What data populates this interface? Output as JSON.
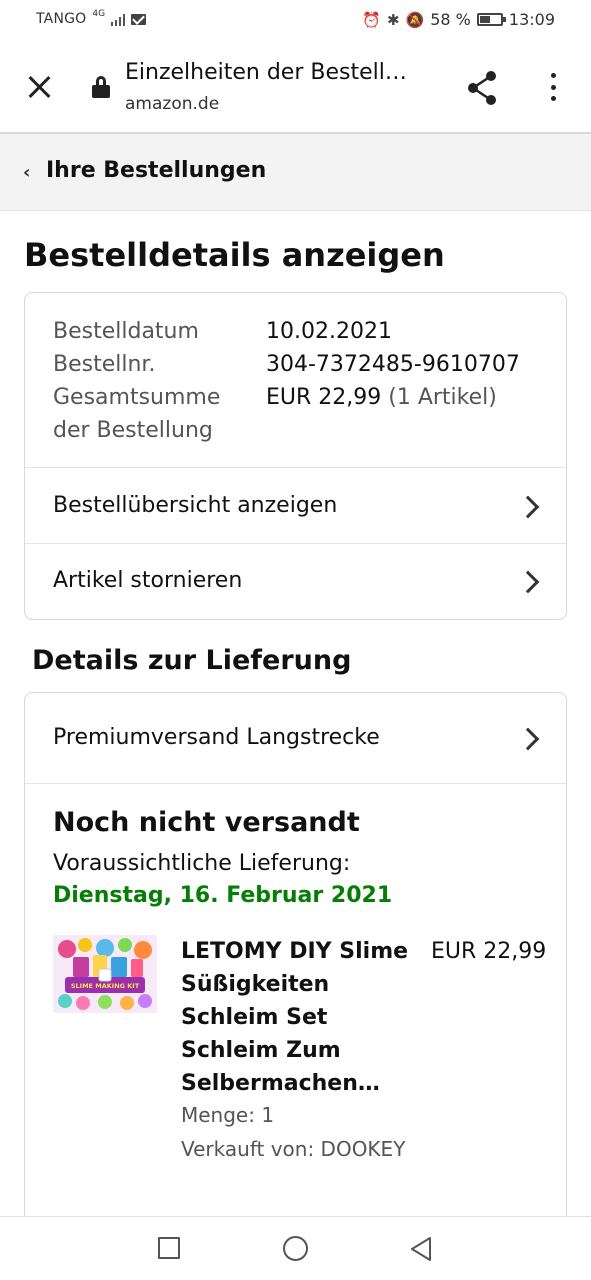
{
  "status_bar": {
    "carrier": "TANGO",
    "network": "4G",
    "battery_percent": "58 %",
    "battery_level": 0.58,
    "time": "13:09",
    "icons": [
      "signal-icon",
      "mail-icon",
      "alarm-icon",
      "bluetooth-icon",
      "mute-icon",
      "battery-icon"
    ]
  },
  "toolbar": {
    "title": "Einzelheiten der Bestell…",
    "domain": "amazon.de",
    "icons": [
      "close-icon",
      "lock-icon",
      "share-icon",
      "more-vert-icon"
    ]
  },
  "breadcrumb": {
    "label": "Ihre Bestellungen"
  },
  "page": {
    "title": "Bestelldetails anzeigen"
  },
  "order": {
    "date_label": "Bestelldatum",
    "date": "10.02.2021",
    "number_label": "Bestellnr.",
    "number": "304-7372485-9610707",
    "total_label_1": "Gesamtsumme",
    "total_label_2": "der Bestellung",
    "total": "EUR 22,99",
    "items_count": "(1 Artikel)",
    "view_summary": "Bestellübersicht anzeigen",
    "cancel_items": "Artikel stornieren"
  },
  "delivery": {
    "heading": "Details zur Lieferung",
    "shipping_method": "Premiumversand Langstrecke",
    "status": "Noch nicht versandt",
    "expected_label": "Voraussichtliche Lieferung:",
    "expected_date": "Dienstag, 16. Februar 2021",
    "expected_date_color": "#067d06"
  },
  "product": {
    "title": "LETOMY DIY Slime Süßigkeiten Schleim Set Schleim Zum Selbermachen…",
    "price": "EUR 22,99",
    "quantity": "Menge: 1",
    "seller": "Verkauft von: DOOKEY",
    "image_label": "SLIME MAKING KIT"
  },
  "nav_bar": {
    "icons": [
      "recents-square-icon",
      "home-circle-icon",
      "back-triangle-icon"
    ]
  }
}
